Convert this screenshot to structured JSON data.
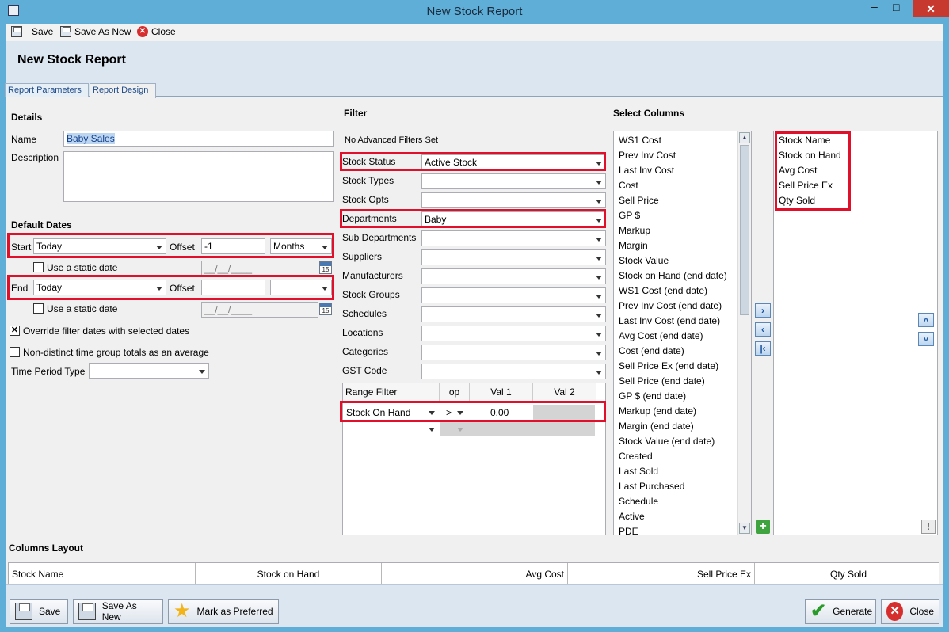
{
  "window": {
    "title": "New Stock Report"
  },
  "toolbar": {
    "save": "Save",
    "save_as_new": "Save As New",
    "close": "Close"
  },
  "page_title": "New Stock Report",
  "tabs": [
    "Report Parameters",
    "Report Design"
  ],
  "details": {
    "heading": "Details",
    "name_label": "Name",
    "name_value": "Baby Sales",
    "description_label": "Description",
    "description_value": ""
  },
  "default_dates": {
    "heading": "Default Dates",
    "start_label": "Start",
    "start_value": "Today",
    "offset_label": "Offset",
    "start_offset": "-1",
    "start_unit": "Months",
    "static_date_label": "Use a static date",
    "date_placeholder": "__/__/____",
    "end_label": "End",
    "end_value": "Today",
    "end_offset": "",
    "end_unit": "",
    "override_label": "Override filter dates with selected dates",
    "override_checked": true,
    "nondistinct_label": "Non-distinct time group totals as an average",
    "nondistinct_checked": false,
    "time_period_label": "Time Period Type",
    "time_period_value": ""
  },
  "filter": {
    "heading": "Filter",
    "advanced_note": "No Advanced Filters Set",
    "rows": [
      {
        "label": "Stock Status",
        "value": "Active Stock"
      },
      {
        "label": "Stock Types",
        "value": ""
      },
      {
        "label": "Stock Opts",
        "value": ""
      },
      {
        "label": "Departments",
        "value": "Baby"
      },
      {
        "label": "Sub Departments",
        "value": ""
      },
      {
        "label": "Suppliers",
        "value": ""
      },
      {
        "label": "Manufacturers",
        "value": ""
      },
      {
        "label": "Stock Groups",
        "value": ""
      },
      {
        "label": "Schedules",
        "value": ""
      },
      {
        "label": "Locations",
        "value": ""
      },
      {
        "label": "Categories",
        "value": ""
      },
      {
        "label": "GST Code",
        "value": ""
      }
    ],
    "range": {
      "headers": [
        "Range Filter",
        "op",
        "Val 1",
        "Val 2"
      ],
      "row_field": "Stock On Hand",
      "row_op": ">",
      "row_val1": "0.00",
      "row_val2": ""
    }
  },
  "select_columns": {
    "heading": "Select Columns",
    "available": [
      "WS1 Cost",
      "Prev Inv Cost",
      "Last Inv Cost",
      "Cost",
      "Sell Price",
      "GP $",
      "Markup",
      "Margin",
      "Stock Value",
      "Stock on Hand (end date)",
      "WS1 Cost (end date)",
      "Prev Inv Cost (end date)",
      "Last Inv Cost (end date)",
      "Avg Cost (end date)",
      "Cost (end date)",
      "Sell Price Ex (end date)",
      "Sell Price (end date)",
      "GP $ (end date)",
      "Markup (end date)",
      "Margin (end date)",
      "Stock Value (end date)",
      "Created",
      "Last Sold",
      "Last Purchased",
      "Schedule",
      "Active",
      "PDE"
    ],
    "selected": [
      "Stock Name",
      "Stock on Hand",
      "Avg Cost",
      "Sell Price Ex",
      "Qty Sold"
    ]
  },
  "columns_layout": {
    "heading": "Columns Layout",
    "columns": [
      "Stock Name",
      "Stock on Hand",
      "Avg Cost",
      "Sell Price Ex",
      "Qty Sold"
    ]
  },
  "footer": {
    "save": "Save",
    "save_as_new": "Save As New",
    "mark_preferred": "Mark as Preferred",
    "generate": "Generate",
    "close": "Close"
  }
}
